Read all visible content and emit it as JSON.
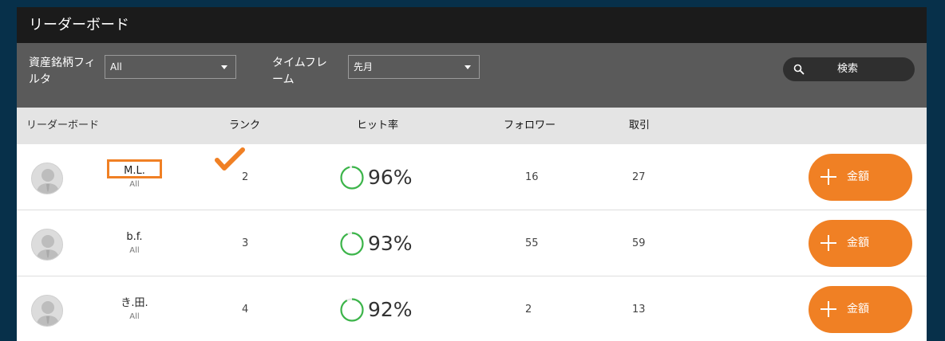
{
  "app": {
    "title": "リーダーボード"
  },
  "filters": {
    "asset_label": "資産銘柄フィルタ",
    "asset_value": "All",
    "timeframe_label": "タイムフレーム",
    "timeframe_value": "先月",
    "search_label": "検索"
  },
  "columns": {
    "leaderboard": "リーダーボード",
    "rank": "ランク",
    "hit_rate": "ヒット率",
    "followers": "フォロワー",
    "trades": "取引"
  },
  "rows": [
    {
      "name": "M.L.",
      "filter": "All",
      "rank": "2",
      "hit_rate": "96%",
      "hit_value": 96,
      "followers": "16",
      "trades": "27",
      "button": "金額",
      "highlighted": true
    },
    {
      "name": "b.f.",
      "filter": "All",
      "rank": "3",
      "hit_rate": "93%",
      "hit_value": 93,
      "followers": "55",
      "trades": "59",
      "button": "金額",
      "highlighted": false
    },
    {
      "name": "き.田.",
      "filter": "All",
      "rank": "4",
      "hit_rate": "92%",
      "hit_value": 92,
      "followers": "2",
      "trades": "13",
      "button": "金額",
      "highlighted": false
    }
  ],
  "icons": {
    "search": "search-icon",
    "dropdown": "chevron-down-icon",
    "avatar": "user-avatar-icon",
    "plus": "plus-icon",
    "check": "checkmark-icon"
  },
  "colors": {
    "accent": "#f08024",
    "ring": "#3cb54a",
    "title_bar": "#1b1b1b",
    "filter_bar": "#5a5a5a",
    "header_row": "#e4e4e4",
    "page_bg": "#07304a"
  }
}
